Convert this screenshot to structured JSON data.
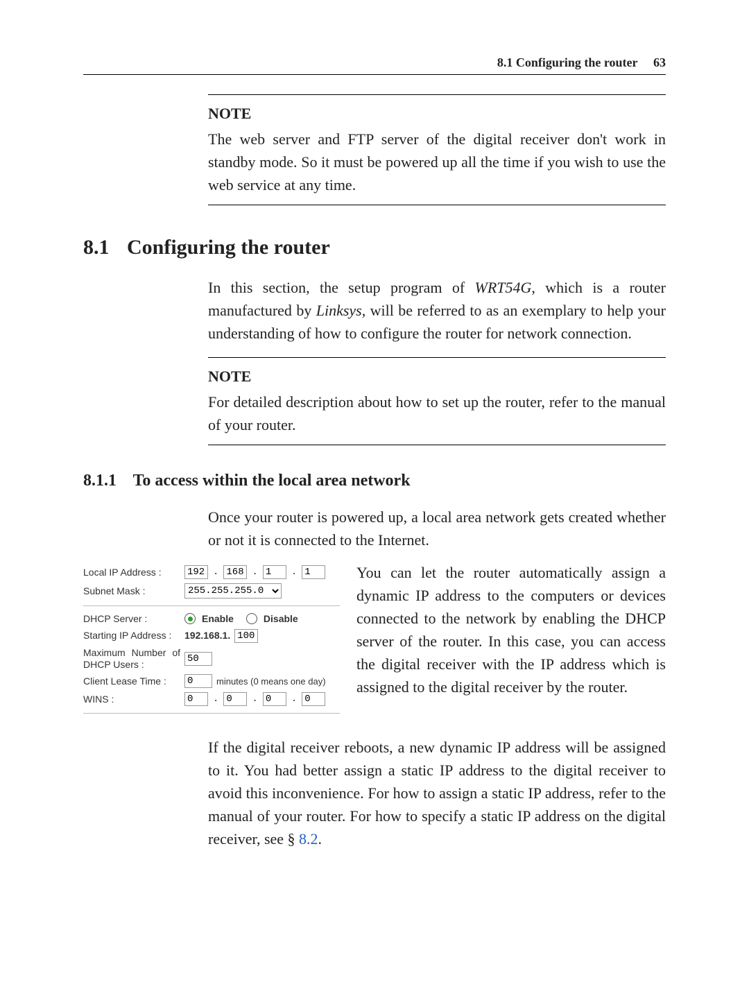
{
  "header": {
    "section_ref": "8.1 Configuring the router",
    "page_number": "63"
  },
  "note1": {
    "heading": "NOTE",
    "body": "The web server and FTP server of the digital receiver don't work in standby mode. So it must be powered up all the time if you wish to use the web service at any time."
  },
  "section": {
    "number": "8.1",
    "title": "Configuring the router",
    "intro_pre": "In this section, the setup program of ",
    "intro_em1": "WRT54G",
    "intro_mid": ", which is a router manufactured by ",
    "intro_em2": "Linksys",
    "intro_post": ", will be referred to as an exemplary to help your understanding of how to configure the router for network connection."
  },
  "note2": {
    "heading": "NOTE",
    "body": "For detailed description about how to set up the router, refer to the manual of your router."
  },
  "subsection": {
    "number": "8.1.1",
    "title": "To access within the local area network",
    "para1": "Once your router is powered up, a local area network gets created whether or not it is connected to the Internet.",
    "side_para": "You can let the router automatically assign a dynamic IP address to the computers or devices connected to the network by enabling the DHCP server of the router. In this case, you can access the digital receiver with the IP address which is assigned to the digital receiver by the router.",
    "para2_pre": "If the digital receiver reboots, a new dynamic IP address will be assigned to it. You had better assign a static IP address to the digital receiver to avoid this inconvenience. For how to assign a static IP address, refer to the manual of your router. For how to specify a static IP address on the digital receiver, see § ",
    "para2_link": "8.2",
    "para2_post": "."
  },
  "router": {
    "labels": {
      "local_ip": "Local IP Address :",
      "subnet": "Subnet Mask :",
      "dhcp_server": "DHCP Server :",
      "starting_ip": "Starting IP Address :",
      "max_users": "Maximum Number of DHCP Users :",
      "lease_time": "Client Lease Time :",
      "wins": "WINS :"
    },
    "local_ip": [
      "192",
      "168",
      "1",
      "1"
    ],
    "subnet_mask": "255.255.255.0",
    "dhcp_enable": "Enable",
    "dhcp_disable": "Disable",
    "starting_prefix": "192.168.1.",
    "starting_value": "100",
    "max_users_value": "50",
    "lease_value": "0",
    "lease_suffix": "minutes (0 means one day)",
    "wins": [
      "0",
      "0",
      "0",
      "0"
    ]
  }
}
